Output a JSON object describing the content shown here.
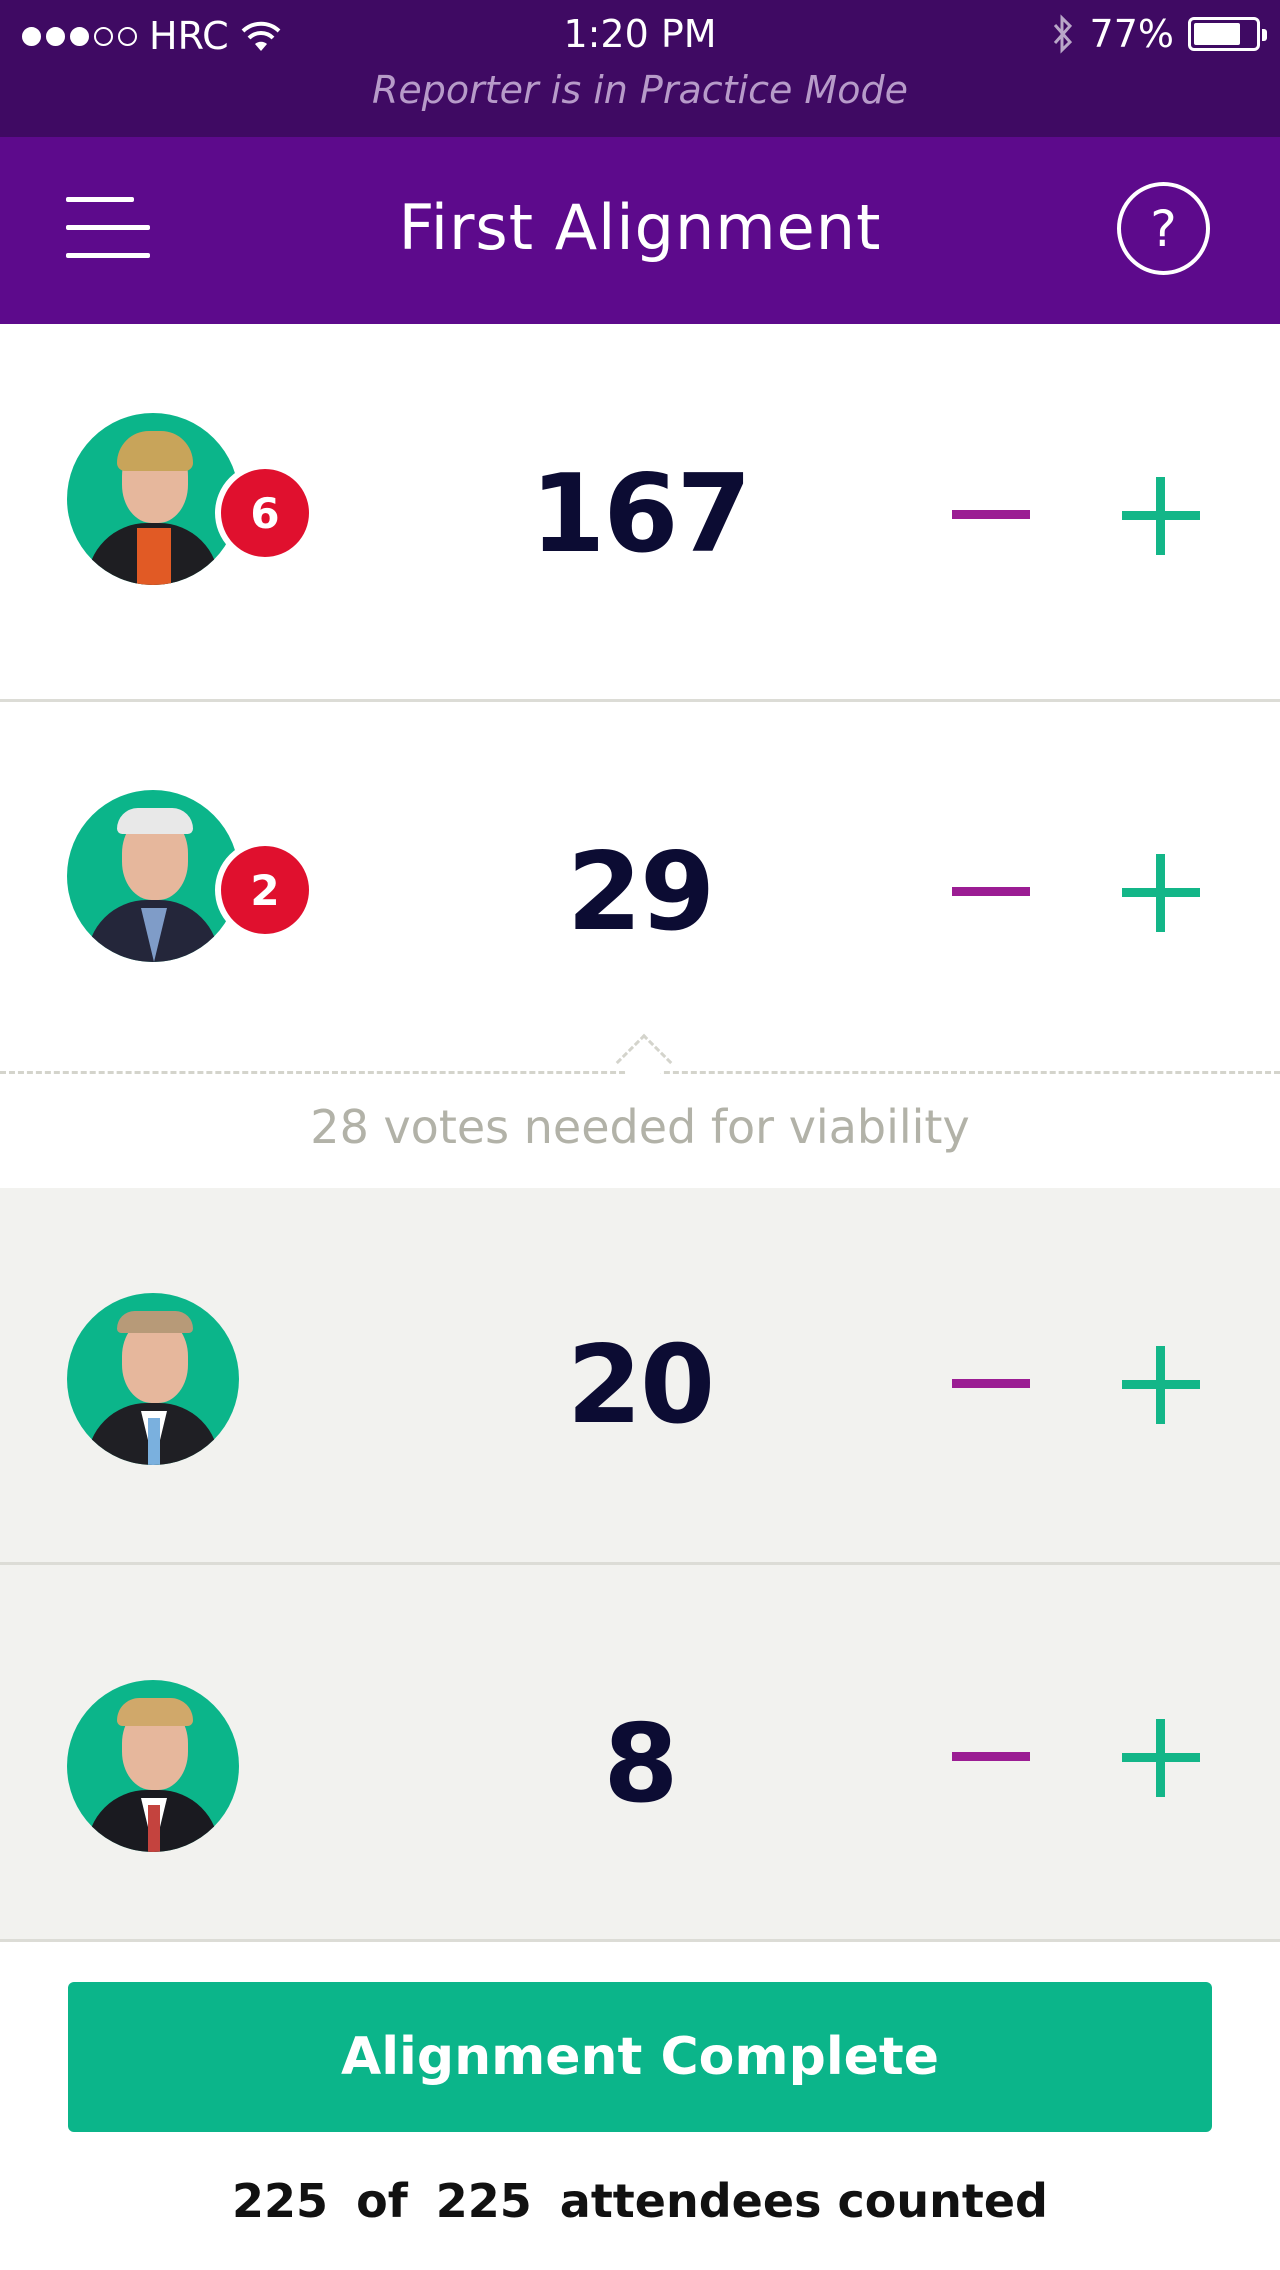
{
  "status_bar": {
    "carrier": "HRC",
    "time": "1:20 PM",
    "battery": "77%",
    "battery_level": 0.77,
    "signal_dots_filled": 3,
    "signal_dots_total": 5,
    "mode_notice": "Reporter is in Practice Mode"
  },
  "nav": {
    "title": "First Alignment",
    "menu_icon": "hamburger-menu-icon",
    "help_label": "?"
  },
  "candidates": [
    {
      "count": "167",
      "badge": "6"
    },
    {
      "count": "29",
      "badge": "2"
    },
    {
      "count": "20",
      "badge": null
    },
    {
      "count": "8",
      "badge": null
    }
  ],
  "viability": {
    "text": "28 votes needed for viability"
  },
  "footer": {
    "button_label": "Alignment Complete",
    "counted": "225",
    "of_label": "of",
    "total": "225",
    "suffix": "attendees counted"
  },
  "colors": {
    "status_bar_bg": "#3f0a63",
    "nav_bg": "#5d0a8c",
    "accent_green": "#0bb58a",
    "minus_purple": "#9b1d93",
    "badge_red": "#e0102e",
    "count_navy": "#0c0c33"
  }
}
